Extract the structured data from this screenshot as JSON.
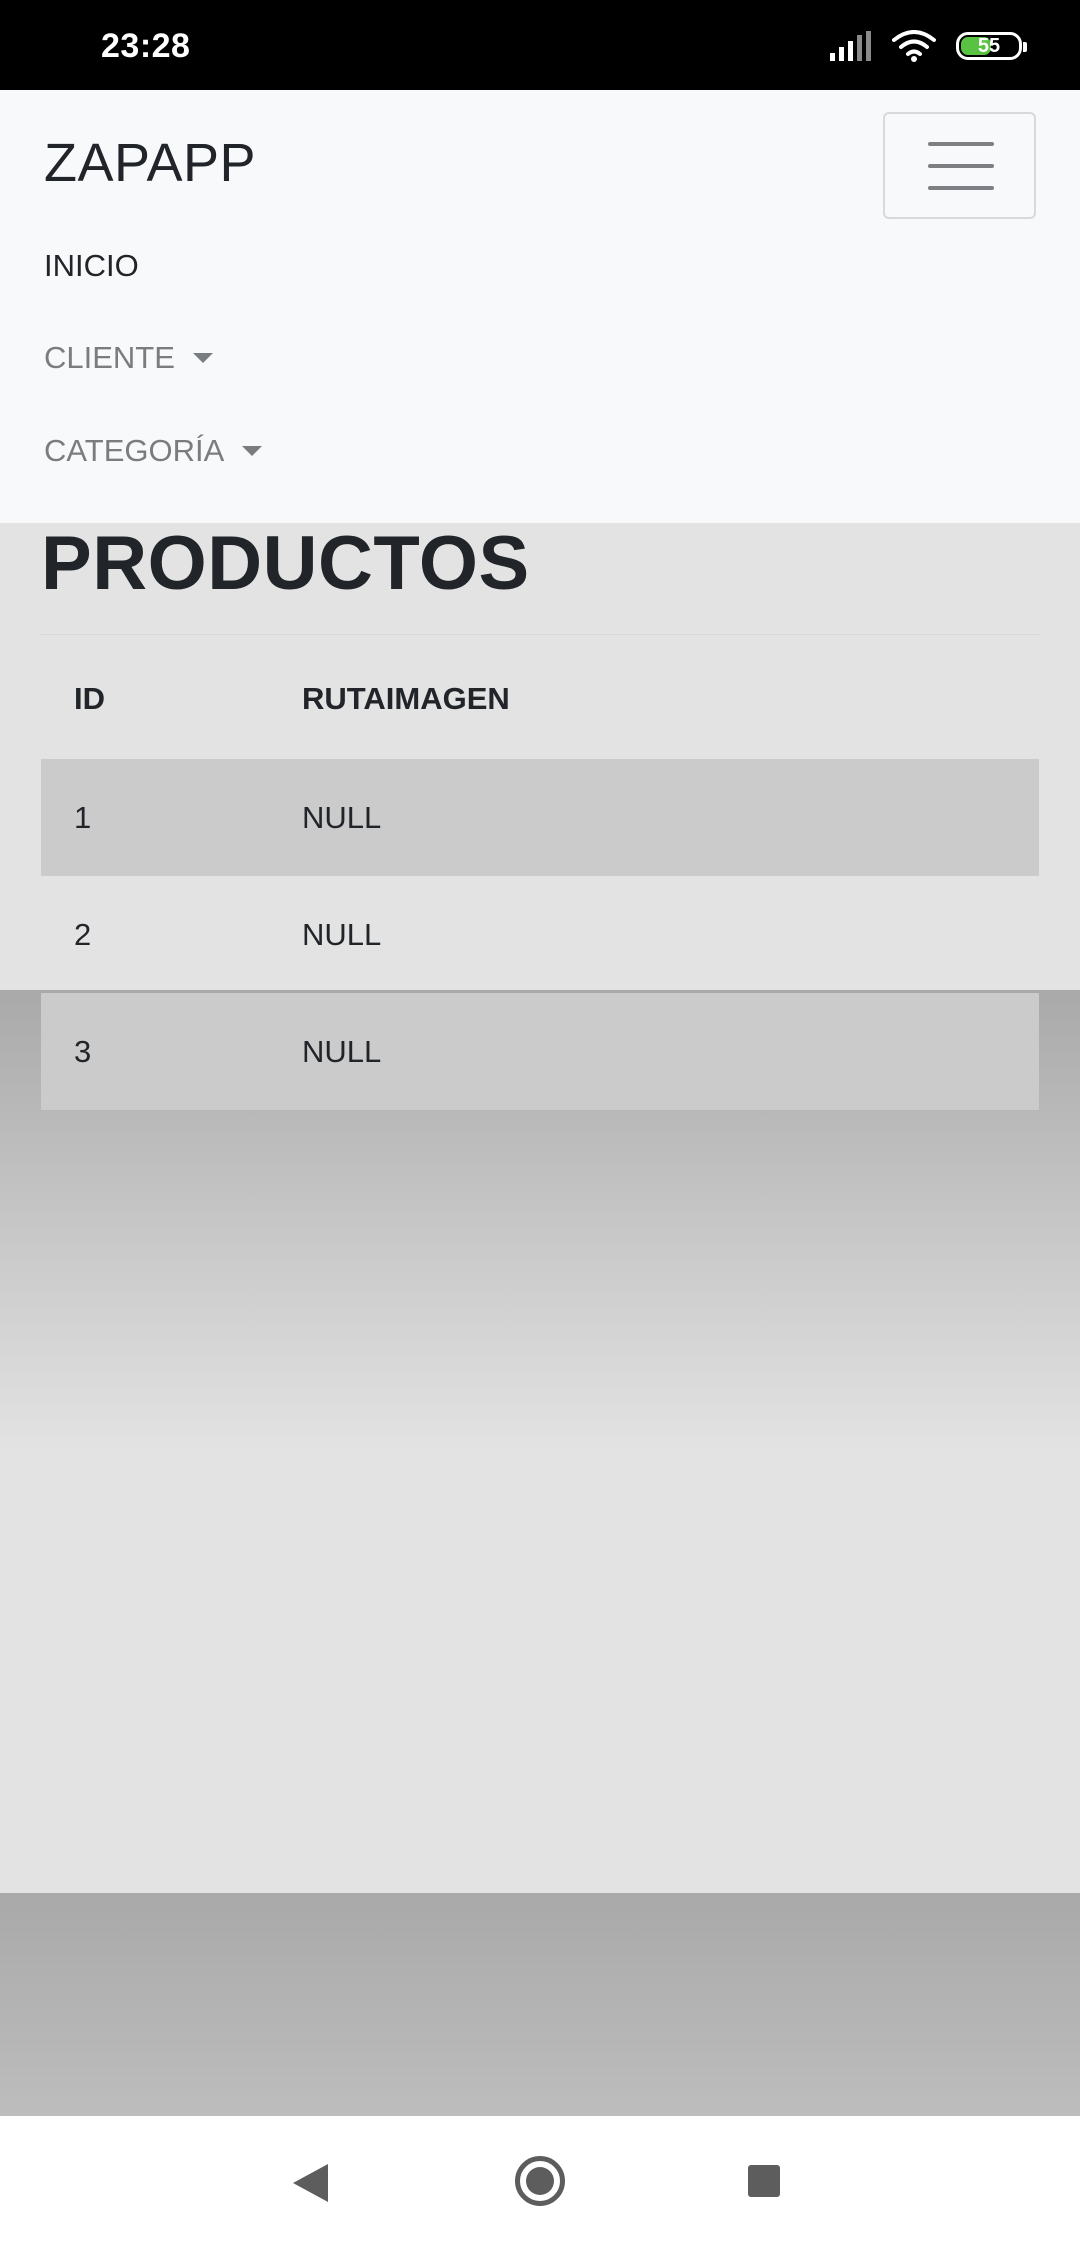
{
  "status_bar": {
    "time": "23:28",
    "battery": "55",
    "icons": [
      "signal-icon",
      "wifi-icon",
      "battery-icon"
    ]
  },
  "navbar": {
    "brand": "ZAPAPP",
    "toggler_icon": "hamburger-menu-icon",
    "links": [
      {
        "label": "INICIO",
        "dropdown": false
      },
      {
        "label": "CLIENTE",
        "dropdown": true
      },
      {
        "label": "CATEGORÍA",
        "dropdown": true
      }
    ]
  },
  "main": {
    "title": "PRODUCTOS",
    "table": {
      "headers": [
        "ID",
        "RUTAIMAGEN"
      ],
      "rows": [
        [
          "1",
          "NULL"
        ],
        [
          "2",
          "NULL"
        ],
        [
          "3",
          "NULL"
        ]
      ]
    }
  },
  "system_nav": {
    "icons": [
      "back-icon",
      "home-icon",
      "recents-icon"
    ]
  },
  "colors": {
    "navbar_bg": "#f8f9fa",
    "text": "#212529",
    "muted_link": "#7a7d80",
    "striped_row": "#cbcbcb",
    "battery_fill": "#5ac242"
  }
}
